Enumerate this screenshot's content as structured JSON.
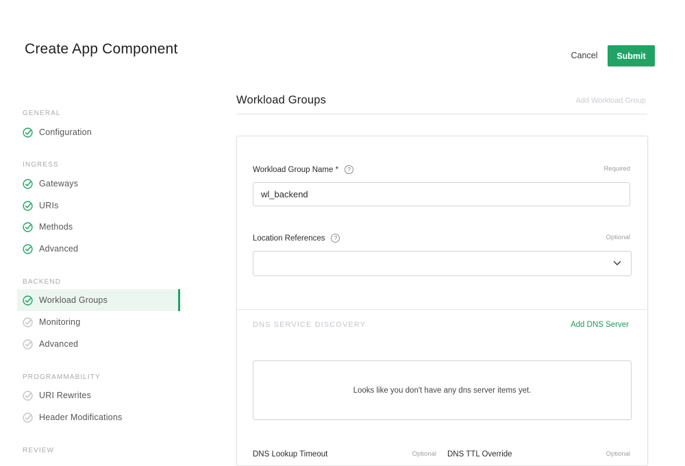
{
  "header": {
    "title": "Create App Component",
    "cancel_label": "Cancel",
    "submit_label": "Submit"
  },
  "sidebar": {
    "sections": [
      {
        "label": "GENERAL",
        "items": [
          {
            "label": "Configuration",
            "status": "complete"
          }
        ]
      },
      {
        "label": "INGRESS",
        "items": [
          {
            "label": "Gateways",
            "status": "complete"
          },
          {
            "label": "URIs",
            "status": "complete"
          },
          {
            "label": "Methods",
            "status": "complete"
          },
          {
            "label": "Advanced",
            "status": "complete"
          }
        ]
      },
      {
        "label": "BACKEND",
        "items": [
          {
            "label": "Workload Groups",
            "status": "complete",
            "active": true
          },
          {
            "label": "Monitoring",
            "status": "pending"
          },
          {
            "label": "Advanced",
            "status": "pending"
          }
        ]
      },
      {
        "label": "PROGRAMMABILITY",
        "items": [
          {
            "label": "URI Rewrites",
            "status": "pending"
          },
          {
            "label": "Header Modifications",
            "status": "pending"
          }
        ]
      },
      {
        "label": "REVIEW",
        "items": []
      }
    ]
  },
  "main": {
    "section_title": "Workload Groups",
    "add_workload_group_label": "Add Workload Group",
    "form": {
      "workload_group_name": {
        "label": "Workload Group Name *",
        "tag": "Required",
        "value": "wl_backend"
      },
      "location_references": {
        "label": "Location References",
        "tag": "Optional",
        "value": ""
      },
      "dns": {
        "title": "DNS SERVICE DISCOVERY",
        "add_label": "Add DNS Server",
        "empty_text": "Looks like you don't have any dns server items yet."
      },
      "dns_lookup_timeout": {
        "label": "DNS Lookup Timeout",
        "tag": "Optional"
      },
      "dns_ttl_override": {
        "label": "DNS TTL Override",
        "tag": "Optional"
      }
    }
  },
  "colors": {
    "accent": "#21a366",
    "complete_check": "#21a366",
    "pending_check": "#c4c4c4"
  },
  "icons": {
    "complete": "check-circle-icon",
    "pending": "check-circle-outline-icon",
    "help": "help-icon",
    "dropdown": "chevron-down-icon"
  }
}
